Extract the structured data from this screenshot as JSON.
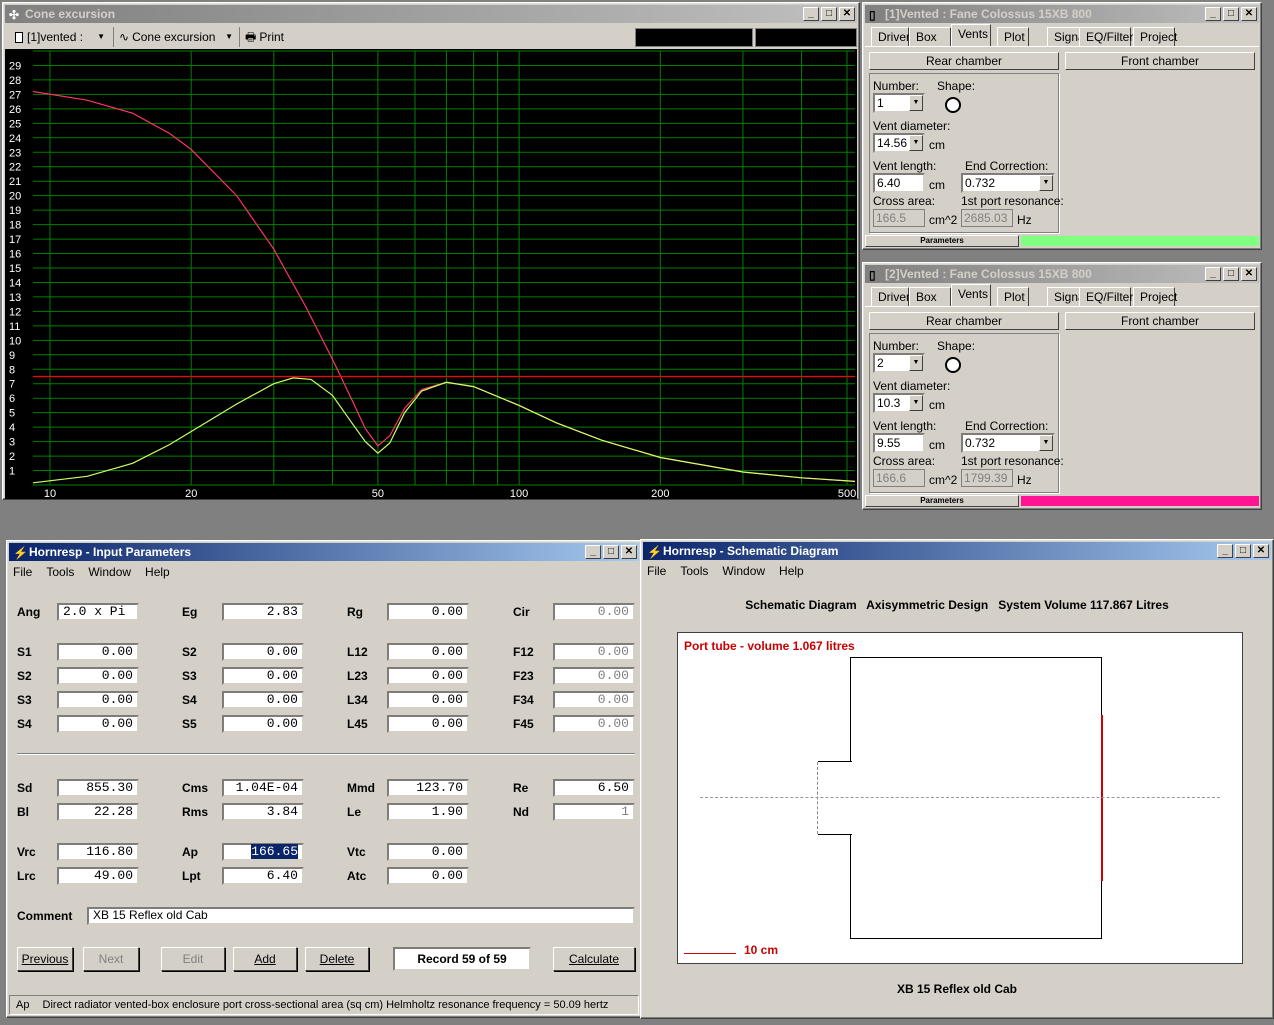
{
  "cone": {
    "title": "Cone excursion",
    "record_select": "[1]vented :",
    "plot_select": "Cone excursion",
    "print_label": "Print"
  },
  "chart_data": {
    "type": "line",
    "title": "",
    "xlabel": "",
    "ylabel": "",
    "x_scale": "log",
    "xlim": [
      9.2,
      520
    ],
    "ylim": [
      0,
      30
    ],
    "x_ticks": [
      "10",
      "20",
      "50",
      "100",
      "200",
      "500"
    ],
    "y_ticks": [
      "1",
      "2",
      "3",
      "4",
      "5",
      "6",
      "7",
      "8",
      "9",
      "10",
      "11",
      "12",
      "13",
      "14",
      "15",
      "16",
      "17",
      "18",
      "19",
      "20",
      "21",
      "22",
      "23",
      "24",
      "25",
      "26",
      "27",
      "28",
      "29"
    ],
    "grid": true,
    "background": "#000000",
    "grid_color": "#008000",
    "series": [
      {
        "color": "#ff3366",
        "x": [
          9.2,
          12,
          15,
          18,
          20,
          25,
          30,
          35,
          40,
          44,
          47,
          50,
          53,
          57,
          62,
          70,
          80,
          100,
          120,
          150,
          200,
          300,
          400,
          520
        ],
        "y": [
          27.2,
          26.6,
          25.7,
          24.3,
          23.2,
          20.0,
          16.3,
          12.4,
          8.7,
          5.9,
          3.9,
          2.7,
          3.4,
          5.3,
          6.6,
          7.1,
          6.8,
          5.5,
          4.3,
          3.1,
          1.9,
          0.9,
          0.5,
          0.25
        ]
      },
      {
        "color": "#ccff66",
        "x": [
          9.2,
          12,
          15,
          18,
          20,
          25,
          30,
          33,
          36,
          40,
          44,
          47,
          50,
          53,
          57,
          62,
          70,
          80,
          100,
          120,
          150,
          200,
          300,
          400,
          520
        ],
        "y": [
          0.15,
          0.6,
          1.5,
          2.8,
          3.7,
          5.6,
          7.0,
          7.4,
          7.3,
          6.2,
          4.3,
          3.0,
          2.2,
          2.9,
          5.0,
          6.5,
          7.1,
          6.8,
          5.5,
          4.3,
          3.1,
          1.9,
          0.9,
          0.5,
          0.25
        ]
      },
      {
        "color": "#ff0000",
        "x": [
          9.2,
          520
        ],
        "y": [
          7.5,
          7.5
        ]
      }
    ]
  },
  "vent_windows": [
    {
      "title": "[1]Vented : Fane Colossus 15XB 800",
      "tabs": [
        "Driver",
        "Box",
        "Vents",
        "Plot",
        "Signal",
        "EQ/Filter",
        "Project"
      ],
      "rear_chamber": "Rear chamber",
      "front_chamber": "Front chamber",
      "number_label": "Number:",
      "number_value": "1",
      "shape_label": "Shape:",
      "vent_diameter_label": "Vent diameter:",
      "vent_diameter_value": "14.56",
      "vent_diameter_unit": "cm",
      "vent_length_label": "Vent length:",
      "vent_length_value": "6.40",
      "vent_length_unit": "cm",
      "end_correction_label": "End Correction:",
      "end_correction_value": "0.732",
      "cross_area_label": "Cross area:",
      "cross_area_value": "166.5",
      "cross_area_unit": "cm^2",
      "port_res_label": "1st port resonance:",
      "port_res_value": "2685.03",
      "port_res_unit": "Hz",
      "parameters_label": "Parameters",
      "status_color": "#80ff80"
    },
    {
      "title": "[2]Vented : Fane Colossus 15XB 800",
      "tabs": [
        "Driver",
        "Box",
        "Vents",
        "Plot",
        "Signal",
        "EQ/Filter",
        "Project"
      ],
      "rear_chamber": "Rear chamber",
      "front_chamber": "Front chamber",
      "number_label": "Number:",
      "number_value": "2",
      "shape_label": "Shape:",
      "vent_diameter_label": "Vent diameter:",
      "vent_diameter_value": "10.3",
      "vent_diameter_unit": "cm",
      "vent_length_label": "Vent length:",
      "vent_length_value": "9.55",
      "vent_length_unit": "cm",
      "end_correction_label": "End Correction:",
      "end_correction_value": "0.732",
      "cross_area_label": "Cross area:",
      "cross_area_value": "166.6",
      "cross_area_unit": "cm^2",
      "port_res_label": "1st port resonance:",
      "port_res_value": "1799.39",
      "port_res_unit": "Hz",
      "parameters_label": "Parameters",
      "status_color": "#ff1493"
    }
  ],
  "input": {
    "title": "Hornresp - Input Parameters",
    "menu": [
      "File",
      "Tools",
      "Window",
      "Help"
    ],
    "params": [
      {
        "label": "Ang",
        "value": "2.0 x Pi",
        "disabled": false
      },
      {
        "label": "Eg",
        "value": "2.83",
        "disabled": false
      },
      {
        "label": "Rg",
        "value": "0.00",
        "disabled": false
      },
      {
        "label": "Cir",
        "value": "0.00",
        "disabled": true
      },
      {
        "label": "S1",
        "value": "0.00",
        "disabled": false
      },
      {
        "label": "S2",
        "value": "0.00",
        "disabled": false
      },
      {
        "label": "L12",
        "value": "0.00",
        "disabled": false
      },
      {
        "label": "F12",
        "value": "0.00",
        "disabled": true
      },
      {
        "label": "S2",
        "value": "0.00",
        "disabled": false
      },
      {
        "label": "S3",
        "value": "0.00",
        "disabled": false
      },
      {
        "label": "L23",
        "value": "0.00",
        "disabled": false
      },
      {
        "label": "F23",
        "value": "0.00",
        "disabled": true
      },
      {
        "label": "S3",
        "value": "0.00",
        "disabled": false
      },
      {
        "label": "S4",
        "value": "0.00",
        "disabled": false
      },
      {
        "label": "L34",
        "value": "0.00",
        "disabled": false
      },
      {
        "label": "F34",
        "value": "0.00",
        "disabled": true
      },
      {
        "label": "S4",
        "value": "0.00",
        "disabled": false
      },
      {
        "label": "S5",
        "value": "0.00",
        "disabled": false
      },
      {
        "label": "L45",
        "value": "0.00",
        "disabled": false
      },
      {
        "label": "F45",
        "value": "0.00",
        "disabled": true
      },
      {
        "label": "Sd",
        "value": "855.30",
        "disabled": false
      },
      {
        "label": "Cms",
        "value": "1.04E-04",
        "disabled": false
      },
      {
        "label": "Mmd",
        "value": "123.70",
        "disabled": false
      },
      {
        "label": "Re",
        "value": "6.50",
        "disabled": false
      },
      {
        "label": "Bl",
        "value": "22.28",
        "disabled": false
      },
      {
        "label": "Rms",
        "value": "3.84",
        "disabled": false
      },
      {
        "label": "Le",
        "value": "1.90",
        "disabled": false
      },
      {
        "label": "Nd",
        "value": "1",
        "disabled": true
      },
      {
        "label": "Vrc",
        "value": "116.80",
        "disabled": false
      },
      {
        "label": "Ap",
        "value": "166.65",
        "disabled": false,
        "selected": true
      },
      {
        "label": "Vtc",
        "value": "0.00",
        "disabled": false
      },
      {
        "label": "Lrc",
        "value": "49.00",
        "disabled": false
      },
      {
        "label": "Lpt",
        "value": "6.40",
        "disabled": false
      },
      {
        "label": "Atc",
        "value": "0.00",
        "disabled": false
      }
    ],
    "comment_label": "Comment",
    "comment_value": "XB 15 Reflex old Cab",
    "buttons": {
      "previous": "Previous",
      "next": "Next",
      "edit": "Edit",
      "add": "Add",
      "delete": "Delete",
      "calculate": "Calculate"
    },
    "record": "Record 59 of 59",
    "status_key": "Ap",
    "status_text": "Direct radiator vented-box enclosure port cross-sectional area  (sq cm)   Helmholtz resonance frequency = 50.09 hertz"
  },
  "schematic": {
    "title": "Hornresp - Schematic Diagram",
    "menu": [
      "File",
      "Tools",
      "Window",
      "Help"
    ],
    "header": "Schematic Diagram   Axisymmetric Design   System Volume 117.867 Litres",
    "port_label": "Port tube - volume 1.067 litres",
    "scale_label": "10 cm",
    "caption": "XB 15 Reflex old Cab"
  }
}
